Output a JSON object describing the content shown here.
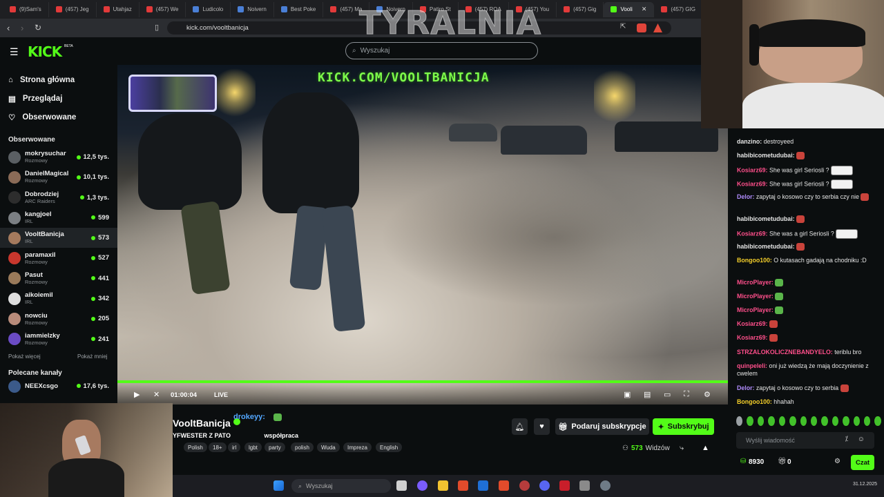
{
  "browser": {
    "tabs": [
      {
        "label": "(9)Sam's"
      },
      {
        "label": "(457) Jeg"
      },
      {
        "label": "Utahjaz"
      },
      {
        "label": "(457) We"
      },
      {
        "label": "Ludicolo"
      },
      {
        "label": "Noivern"
      },
      {
        "label": "Best Poke"
      },
      {
        "label": "(457) Ma"
      },
      {
        "label": "Noivern"
      },
      {
        "label": "Patiro St"
      },
      {
        "label": "(457) ROA"
      },
      {
        "label": "(457) You"
      },
      {
        "label": "(457) Gig"
      },
      {
        "label": "Vooli",
        "active": true
      },
      {
        "label": "(457) GIG"
      }
    ],
    "url": "kick.com/vooltbanicja"
  },
  "overlay_title": "TYRALNIA",
  "kick": {
    "logo": "KICK",
    "logo_beta": "BETA",
    "search_placeholder": "Wyszukaj",
    "nav": [
      {
        "label": "Strona główna",
        "icon": "home-icon"
      },
      {
        "label": "Przeglądaj",
        "icon": "browse-icon"
      },
      {
        "label": "Obserwowane",
        "icon": "heart-icon"
      }
    ],
    "following_header": "Obserwowane",
    "channels": [
      {
        "name": "mokrysuchar",
        "category": "Rozmowy",
        "viewers": "12,5 tys."
      },
      {
        "name": "DanielMagical",
        "category": "Rozmowy",
        "viewers": "10,1 tys."
      },
      {
        "name": "Dobrodziej",
        "category": "ARC Raiders",
        "viewers": "1,3 tys."
      },
      {
        "name": "kangjoel",
        "category": "IRL",
        "viewers": "599"
      },
      {
        "name": "VooltBanicja",
        "category": "IRL",
        "viewers": "573",
        "active": true
      },
      {
        "name": "paramaxil",
        "category": "Rozmowy",
        "viewers": "527"
      },
      {
        "name": "Pasut",
        "category": "Rozmowy",
        "viewers": "441"
      },
      {
        "name": "aikoiemil",
        "category": "IRL",
        "viewers": "342"
      },
      {
        "name": "nowciu",
        "category": "Rozmowy",
        "viewers": "205"
      },
      {
        "name": "iammielzky",
        "category": "Rozmowy",
        "viewers": "241"
      }
    ],
    "show_more": "Pokaż więcej",
    "show_less": "Pokaż mniej",
    "recommended_header": "Polecane kanały",
    "recommended": [
      {
        "name": "NEEXcsgo",
        "viewers": "17,6 tys."
      }
    ]
  },
  "video": {
    "overlay_url": "KICK.COM/VOOLTBANICJA",
    "time": "01:00:04",
    "live": "LIVE"
  },
  "stream": {
    "channel": "VooltBanicja",
    "title": "YFWESTER Z PATO",
    "title_suffix": "współpraca",
    "overlay_chat_user": "drokeyy:",
    "tags": [
      "Polish",
      "18+",
      "irl",
      "lgbt",
      "party",
      "polish",
      "Wuda",
      "Impreza",
      "English"
    ],
    "gift_sub_label": "Podaruj subskrypcje",
    "subscribe_label": "Subskrybuj",
    "viewers": "573",
    "viewers_label": "Widzów"
  },
  "chat": {
    "messages": [
      {
        "user": "danzino:",
        "color": "#e6e6e6",
        "text": "destroyeed"
      },
      {
        "user": "habibicometudubai:",
        "color": "#e6e6e6",
        "text": "",
        "emote": "red"
      },
      {
        "user": "Kosiarz69:",
        "color": "#ff4f8b",
        "text": "She was girl Seriosli ?",
        "emote": "xd"
      },
      {
        "user": "Kosiarz69:",
        "color": "#ff4f8b",
        "text": "She was girl Seriosli ?",
        "emote": "xd"
      },
      {
        "user": "Delor:",
        "color": "#b18cff",
        "text": "zapytaj o kosowo czy to serbia czy nie",
        "emote": "red"
      },
      {
        "user": "habibicometudubai:",
        "color": "#e6e6e6",
        "text": "",
        "emote": "red"
      },
      {
        "user": "Kosiarz69:",
        "color": "#ff4f8b",
        "text": "She was a girl Seriosli ?",
        "emote": "xd"
      },
      {
        "user": "habibicometudubai:",
        "color": "#e6e6e6",
        "text": "",
        "emote": "red"
      },
      {
        "user": "Bongoo100:",
        "color": "#f6d02b",
        "text": "O kutasach gadają na chodniku :D"
      },
      {
        "user": "MicroPlayer:",
        "color": "#ff4f8b",
        "text": "",
        "emote": "green"
      },
      {
        "user": "MicroPlayer:",
        "color": "#ff4f8b",
        "text": "",
        "emote": "green"
      },
      {
        "user": "MicroPlayer:",
        "color": "#ff4f8b",
        "text": "",
        "emote": "green"
      },
      {
        "user": "Kosiarz69:",
        "color": "#ff4f8b",
        "text": "",
        "emote": "red"
      },
      {
        "user": "Kosiarz69:",
        "color": "#ff4f8b",
        "text": "",
        "emote": "red"
      },
      {
        "user": "STRZALOKOLICZNEBANDYELO:",
        "color": "#ff4f8b",
        "text": "teriblu bro"
      },
      {
        "user": "quinpeleli:",
        "color": "#ff4f8b",
        "text": "oni już wiedzą że mają doczynienie z cwelem"
      },
      {
        "user": "Delor:",
        "color": "#b18cff",
        "text": "zapytaj o kosowo czy to serbia",
        "emote": "red"
      },
      {
        "user": "Bongoo100:",
        "color": "#f6d02b",
        "text": "hhahah"
      }
    ],
    "input_placeholder": "Wyślij wiadomość",
    "points": "8930",
    "gifts": "0",
    "chat_button": "Czat"
  },
  "taskbar": {
    "search_placeholder": "Wyszukaj",
    "date": "31.12.2025"
  },
  "colors": {
    "accent": "#53fc18",
    "background": "#0b0e0f"
  }
}
